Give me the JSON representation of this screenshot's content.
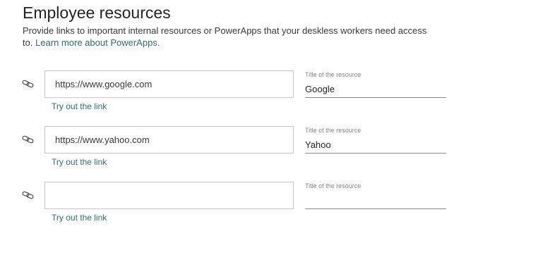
{
  "section": {
    "title": "Employee resources",
    "description": "Provide links to important internal resources or PowerApps that your deskless workers need access to.",
    "learn_more": "Learn more about PowerApps."
  },
  "resources": [
    {
      "icon": "link-icon",
      "url_value": "https://www.google.com",
      "try_link_label": "Try out the link",
      "title_label": "Title of the resource",
      "title_value": "Google"
    },
    {
      "icon": "link-icon",
      "url_value": "https://www.yahoo.com",
      "try_link_label": "Try out the link",
      "title_label": "Title of the resource",
      "title_value": "Yahoo"
    },
    {
      "icon": "link-icon",
      "url_value": "",
      "try_link_label": "Try out the link",
      "title_label": "Title of the resource",
      "title_value": ""
    }
  ],
  "colors": {
    "link": "#2f6f73",
    "border": "#c8c6c4",
    "underline": "#8a8886"
  }
}
